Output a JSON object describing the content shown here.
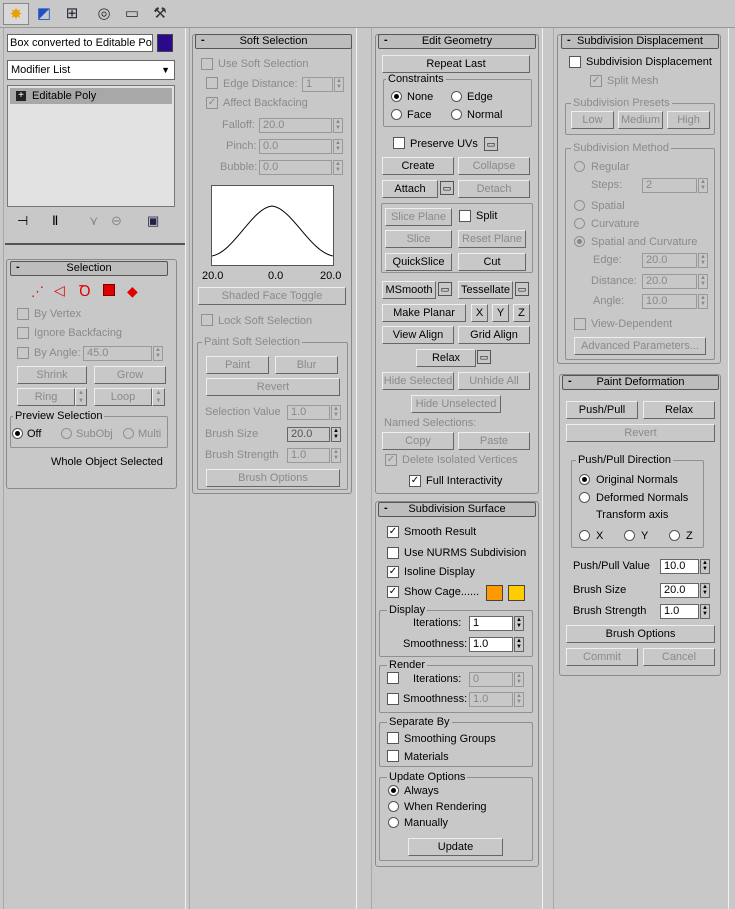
{
  "toolbar": {
    "tabs": [
      "create-icon",
      "modify-icon",
      "hierarchy-icon",
      "motion-icon",
      "display-icon",
      "utilities-icon"
    ]
  },
  "modifier": {
    "object_name": "Box converted to Editable Pol",
    "object_color": "#2a0a8a",
    "list_label": "Modifier List",
    "stack_item": "Editable Poly",
    "stack_expand": "+"
  },
  "selection": {
    "title": "Selection",
    "by_vertex": "By Vertex",
    "ignore_backfacing": "Ignore Backfacing",
    "by_angle": "By Angle:",
    "by_angle_value": "45.0",
    "shrink": "Shrink",
    "grow": "Grow",
    "ring": "Ring",
    "loop": "Loop",
    "preview_title": "Preview Selection",
    "preview_off": "Off",
    "preview_subobj": "SubObj",
    "preview_multi": "Multi",
    "status": "Whole Object Selected"
  },
  "soft": {
    "title": "Soft Selection",
    "use_soft": "Use Soft Selection",
    "edge_distance": "Edge Distance:",
    "edge_distance_value": "1",
    "affect_backfacing": "Affect Backfacing",
    "falloff": "Falloff:",
    "falloff_value": "20.0",
    "pinch": "Pinch:",
    "pinch_value": "0.0",
    "bubble": "Bubble:",
    "bubble_value": "0.0",
    "curve_left": "20.0",
    "curve_mid": "0.0",
    "curve_right": "20.0",
    "shaded_face_toggle": "Shaded Face Toggle",
    "lock_soft": "Lock Soft Selection",
    "paint_title": "Paint Soft Selection",
    "paint": "Paint",
    "blur": "Blur",
    "revert": "Revert",
    "selection_value": "Selection Value",
    "selection_value_v": "1.0",
    "brush_size": "Brush Size",
    "brush_size_v": "20.0",
    "brush_strength": "Brush Strength",
    "brush_strength_v": "1.0",
    "brush_options": "Brush Options"
  },
  "edit": {
    "title": "Edit Geometry",
    "repeat_last": "Repeat Last",
    "constraints": "Constraints",
    "none": "None",
    "edge": "Edge",
    "face": "Face",
    "normal": "Normal",
    "preserve_uvs": "Preserve UVs",
    "create": "Create",
    "collapse": "Collapse",
    "attach": "Attach",
    "detach": "Detach",
    "slice_plane": "Slice Plane",
    "split": "Split",
    "slice": "Slice",
    "reset_plane": "Reset Plane",
    "quickslice": "QuickSlice",
    "cut": "Cut",
    "msmooth": "MSmooth",
    "tessellate": "Tessellate",
    "make_planar": "Make Planar",
    "x": "X",
    "y": "Y",
    "z": "Z",
    "view_align": "View Align",
    "grid_align": "Grid Align",
    "relax": "Relax",
    "hide_selected": "Hide Selected",
    "unhide_all": "Unhide All",
    "hide_unselected": "Hide Unselected",
    "named_selections": "Named Selections:",
    "copy": "Copy",
    "paste": "Paste",
    "delete_isolated": "Delete Isolated Vertices",
    "full_interactivity": "Full Interactivity"
  },
  "subsurf": {
    "title": "Subdivision Surface",
    "smooth_result": "Smooth Result",
    "use_nurms": "Use NURMS Subdivision",
    "isoline": "Isoline Display",
    "show_cage": "Show Cage......",
    "cage_color_1": "#ff9900",
    "cage_color_2": "#ffcc00",
    "display": "Display",
    "iterations": "Iterations:",
    "iterations_v": "1",
    "smoothness": "Smoothness:",
    "smoothness_v": "1.0",
    "render": "Render",
    "r_iterations": "Iterations:",
    "r_iterations_v": "0",
    "r_smoothness": "Smoothness:",
    "r_smoothness_v": "1.0",
    "separate_by": "Separate By",
    "smoothing_groups": "Smoothing Groups",
    "materials": "Materials",
    "update_options": "Update Options",
    "always": "Always",
    "when_rendering": "When Rendering",
    "manually": "Manually",
    "update": "Update"
  },
  "subdisp": {
    "title": "Subdivision Displacement",
    "subdiv_displacement": "Subdivision Displacement",
    "split_mesh": "Split Mesh",
    "presets": "Subdivision Presets",
    "low": "Low",
    "medium": "Medium",
    "high": "High",
    "method": "Subdivision Method",
    "regular": "Regular",
    "steps": "Steps:",
    "steps_v": "2",
    "spatial": "Spatial",
    "curvature": "Curvature",
    "spatial_curvature": "Spatial and Curvature",
    "edge": "Edge:",
    "edge_v": "20.0",
    "distance": "Distance:",
    "distance_v": "20.0",
    "angle": "Angle:",
    "angle_v": "10.0",
    "view_dependent": "View-Dependent",
    "advanced": "Advanced Parameters..."
  },
  "paint": {
    "title": "Paint Deformation",
    "push_pull": "Push/Pull",
    "relax": "Relax",
    "revert": "Revert",
    "direction": "Push/Pull Direction",
    "original_normals": "Original Normals",
    "deformed_normals": "Deformed Normals",
    "transform_axis": "Transform axis",
    "x": "X",
    "y": "Y",
    "z": "Z",
    "push_pull_value": "Push/Pull Value",
    "push_pull_value_v": "10.0",
    "brush_size": "Brush Size",
    "brush_size_v": "20.0",
    "brush_strength": "Brush Strength",
    "brush_strength_v": "1.0",
    "brush_options": "Brush Options",
    "commit": "Commit",
    "cancel": "Cancel"
  }
}
